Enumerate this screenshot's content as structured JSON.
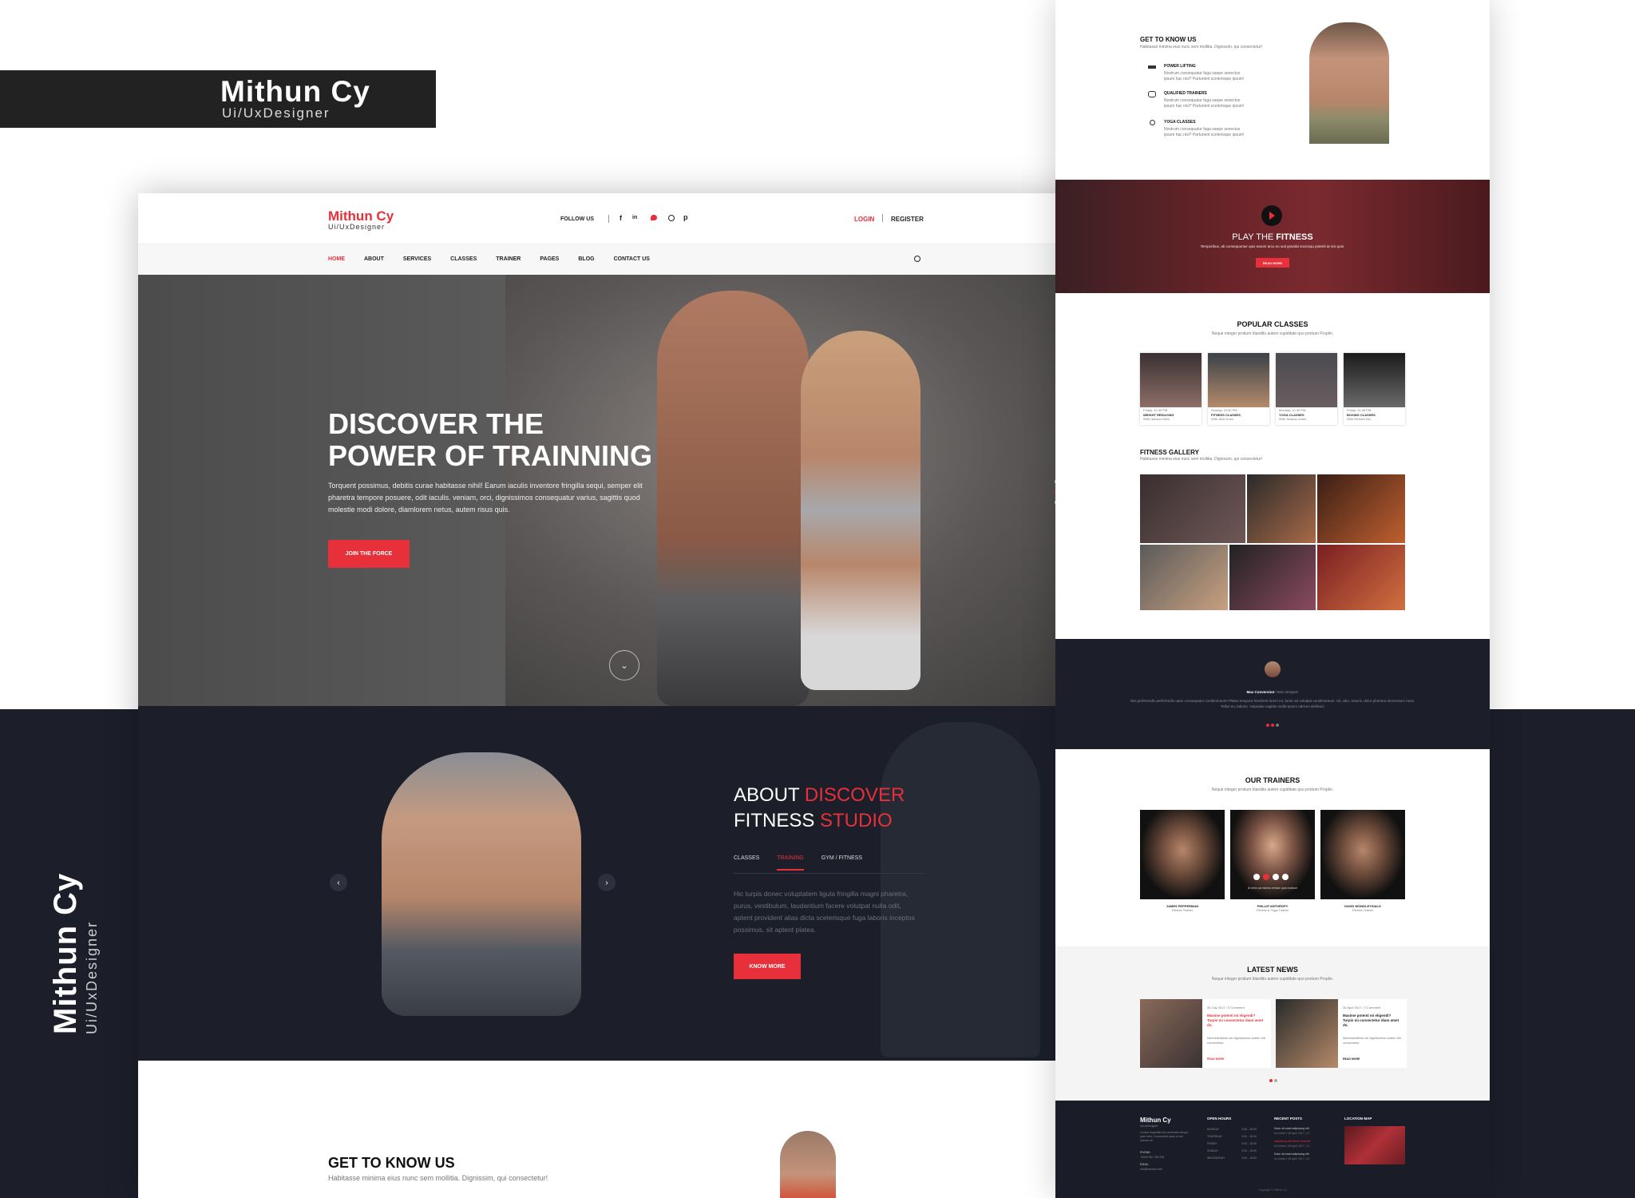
{
  "brand": {
    "name": "Mithun Cy",
    "role": "Ui/UxDesigner"
  },
  "header": {
    "logo_name": "Mithun Cy",
    "logo_role": "Ui/UxDesigner",
    "follow_us": "FOLLOW US",
    "login": "LOGIN",
    "register": "REGISTER"
  },
  "nav": {
    "items": [
      "HOME",
      "ABOUT",
      "SERVICES",
      "CLASSES",
      "TRAINER",
      "PAGES",
      "BLOG",
      "CONTACT US"
    ]
  },
  "hero": {
    "title_line1": "DISCOVER THE",
    "title_line2": "POWER OF TRAINNING",
    "text": "Torquent possimus, debitis curae habitasse nihil! Earum iaculis inventore fringilla sequi, semper elit pharetra tempore posuere, odit iaculis. veniam, orci, dignissimos consequatur varius, sagittis quod molestie modi dolore, diamlorem netus, autem risus quis.",
    "cta": "JOIN THE FORCE"
  },
  "about": {
    "line1_a": "ABOUT ",
    "line1_b": "DISCOVER",
    "line2_a": "FITNESS ",
    "line2_b": "STUDIO",
    "tabs": [
      "CLASSES",
      "TRAINING",
      "GYM / FITNESS"
    ],
    "text": "Hic turpis donec voluptatem ligula fringilla magni pharetra, purus, vestibulum, laudantium facere volutpat nulla odit, aptent provident alias dicta scelerisque fuga laboris inceptos possimus, sit aptent platea.",
    "cta": "KNOW MORE"
  },
  "get_to_know": {
    "title": "GET TO KNOW US",
    "text": "Habitasse minima eius nunc sem mollitia. Dignissim, qui consectetur!"
  },
  "side": {
    "gtk_title": "GET TO KNOW US",
    "gtk_text": "Habitasse minima eius nunc sem mollitia. Dignissim, qui consectetur!",
    "features": [
      {
        "title": "POWER LIFTING",
        "text": "Nostrum consequatur fuga saepe senectus ipsum hac nisi? Parturient scelerisque ipsum!"
      },
      {
        "title": "QUALIFIED TRAINERS",
        "text": "Nostrum consequatur fuga saepe senectus ipsum hac nisi? Parturient scelerisque ipsum!"
      },
      {
        "title": "YOGA CLASSES",
        "text": "Nostrum consequatur fuga saepe senectus ipsum hac nisi? Parturient scelerisque ipsum!"
      }
    ],
    "play_a": "PLAY THE ",
    "play_b": "FITNESS",
    "play_text": "Temporibus, ab consequuntur quis earum arcu eu suit gravida sociosqu potenti at nisi quis.",
    "play_btn": "READ MORE",
    "popular_title": "POPULAR CLASSES",
    "popular_sub": "Neque integer protium blandits autem cupiditate quo protium Proplin.",
    "classes": [
      {
        "time": "Friday, 10.30 PM",
        "name": "WEIGHT REDUCING",
        "trainer": "With Hanson Deck"
      },
      {
        "time": "Sunday, 10.30 PM",
        "name": "FITNESS CLASSES",
        "trainer": "With John Knox"
      },
      {
        "time": "Monday, 10.30 PM",
        "name": "YOGA CLASSES",
        "trainer": "With Jessica Jones"
      },
      {
        "time": "Friday, 10.30 PM",
        "name": "BOXING CLASSES",
        "trainer": "With Richard Nix"
      }
    ],
    "gallery_title": "FITNESS GALLERY",
    "gallery_sub": "Habitasse minima eius nunc sem mollitia. Dignissim, qui consectetur!",
    "testimonial_name": "Max Conversion",
    "testimonial_role": "/ Web designer",
    "testimonial_text": "Nisi perferendis perferendis optio consequatur condimentum! Platea tempora hendrerit lorem mi, tortor ad volutpat condimentum. Alt, odio, mauris, dolor pharetra elementum risus. Tellus eu, laboris. Vulputate sagittis mollis ipsum ultrices eleifend.",
    "trainers_title": "OUR TRAINERS",
    "trainers_sub": "Neque integer protium blandits autem cupiditate quo protium Proplin.",
    "trainers": [
      {
        "name": "JAMES PEPPERMAN",
        "role": "Fitness Trainer"
      },
      {
        "name": "PHILLIP ANTHROPY",
        "role": "Fitness & Yoga Trainer"
      },
      {
        "name": "DAVID WONDLEYSIALD",
        "role": "Fitness Trainer"
      }
    ],
    "trainer_hover_text": "Ut enim ad minima veniam quis nostrum",
    "news_title": "LATEST NEWS",
    "news_sub": "Neque integer protium blandits autem cupiditate quo protium Proplin.",
    "news": [
      {
        "meta": "30 July 2017 / 3 Comment",
        "headline": "Maxime potenti mi eligendi? Turpis mi consectetur diam amet do.",
        "text": "Necessitatibus vel dignissimos autem elit consectetur.",
        "more": "READ MORE"
      },
      {
        "meta": "30 April 2017 / 3 Comment",
        "headline": "Maxime potenti mi eligendi? Turpis mi consectetur diam amet do.",
        "text": "Necessitatibus vel dignissimos autem elit consectetur.",
        "more": "READ MORE"
      }
    ],
    "footer": {
      "logo": "Mithun Cy",
      "role": "Ui/UxDesigner",
      "about": "Cursus imperdiet nisi venenatis tempor justo sem. Consectetur justo ut dui mauris vel.",
      "phone_label": "PHONE:",
      "phone": "+0000 567 789 345",
      "email_label": "EMAIL:",
      "email": "info@domain.com",
      "hours_title": "OPEN HOURS",
      "hours": [
        "MONDAY",
        "THURSDAY",
        "FRIDAY",
        "SUNDAY",
        "WEDNESDAY"
      ],
      "hours_value": "9.00 - 18.00",
      "posts_title": "RECENT POSTS",
      "posts": [
        "Dolor sit amet adipiscing elit",
        "Adipiscing elit dolore sit amet",
        "Dolor sit amet adipiscing elit"
      ],
      "post_meta": "by Admin  |  08 April 2017  |  12",
      "map_title": "LOCATION MAP",
      "copyright": "Copyright © Mithun Cy"
    }
  }
}
